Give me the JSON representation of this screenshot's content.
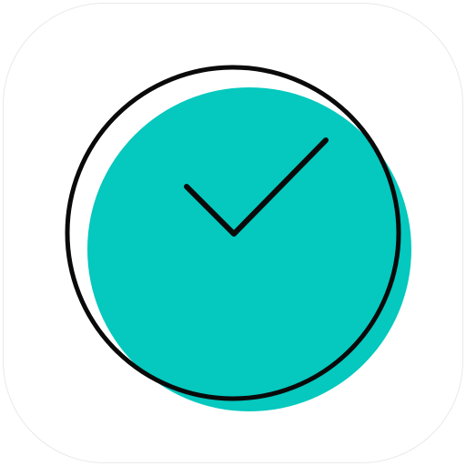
{
  "app_icon": {
    "name": "clock-icon",
    "colors": {
      "background": "#ffffff",
      "tile_border": "#e9e9e9",
      "accent": "#05C8BE",
      "stroke": "#0a0a0a"
    }
  }
}
